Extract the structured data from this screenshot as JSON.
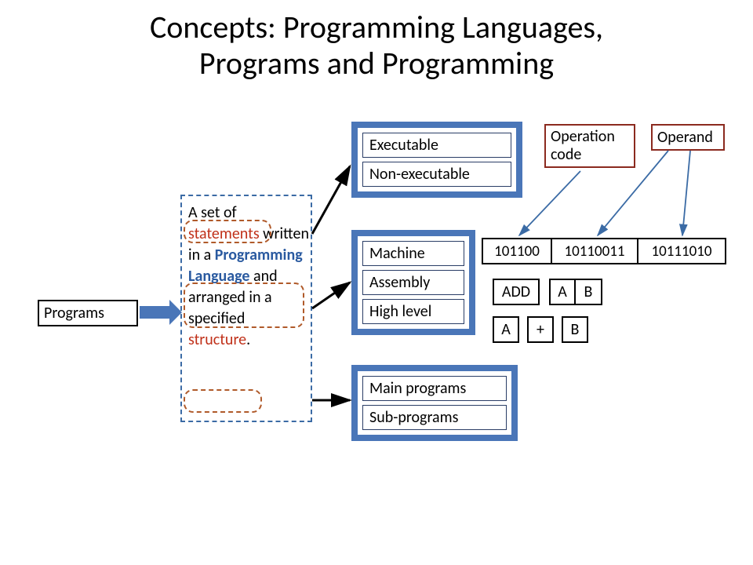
{
  "title_line1": "Concepts: Programming Languages,",
  "title_line2": "Programs and Programming",
  "programs_label": "Programs",
  "description": {
    "part1": "A set of ",
    "kw_statements": "statements",
    "part2": " written in a ",
    "kw_proglang": "Programming Language",
    "part3": "  and arranged in a specified ",
    "kw_structure": "structure",
    "part4": "."
  },
  "exec_group": {
    "item1": "Executable",
    "item2": "Non-executable"
  },
  "level_group": {
    "item1": "Machine",
    "item2": "Assembly",
    "item3": "High level"
  },
  "prog_group": {
    "item1": "Main programs",
    "item2": "Sub-programs"
  },
  "opcode_label": "Operation code",
  "operand_label": "Operand",
  "binary": {
    "c1": "101100",
    "c2": "10110011",
    "c3": "10111010"
  },
  "assembly_row": {
    "c1": "ADD",
    "c2": "A",
    "c3": "B"
  },
  "high_row": {
    "c1": "A",
    "c2": "+",
    "c3": "B"
  }
}
